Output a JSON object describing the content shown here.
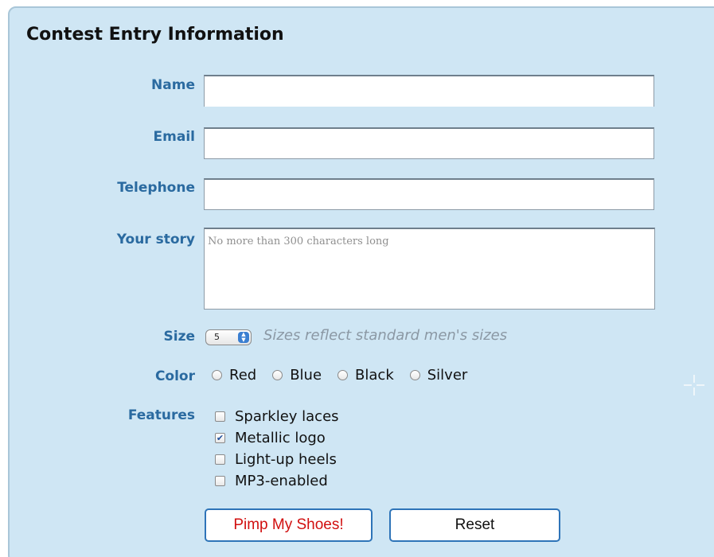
{
  "form": {
    "title": "Contest Entry Information",
    "name_label": "Name",
    "name_value": "",
    "email_label": "Email",
    "email_value": "",
    "telephone_label": "Telephone",
    "telephone_value": "",
    "story_label": "Your story",
    "story_placeholder": "No more than 300 characters long",
    "size_label": "Size",
    "size_value": "5",
    "size_hint": "Sizes reflect standard men's sizes",
    "color_label": "Color",
    "colors": [
      {
        "label": "Red",
        "checked": false
      },
      {
        "label": "Blue",
        "checked": false
      },
      {
        "label": "Black",
        "checked": false
      },
      {
        "label": "Silver",
        "checked": false
      }
    ],
    "features_label": "Features",
    "features": [
      {
        "label": "Sparkley laces",
        "checked": false
      },
      {
        "label": "Metallic logo",
        "checked": true
      },
      {
        "label": "Light-up heels",
        "checked": false
      },
      {
        "label": "MP3-enabled",
        "checked": false
      }
    ],
    "submit_label": "Pimp My Shoes!",
    "reset_label": "Reset"
  },
  "colors": {
    "panel_bg": "#cfe6f4",
    "label": "#2a6aa0",
    "button_border": "#2e74b8",
    "submit_text": "#d10f0f"
  },
  "icons": {
    "select_arrows": "up-down-arrows-icon",
    "checkmark": "checkmark-icon",
    "cursor": "crosshair-cursor-icon"
  }
}
